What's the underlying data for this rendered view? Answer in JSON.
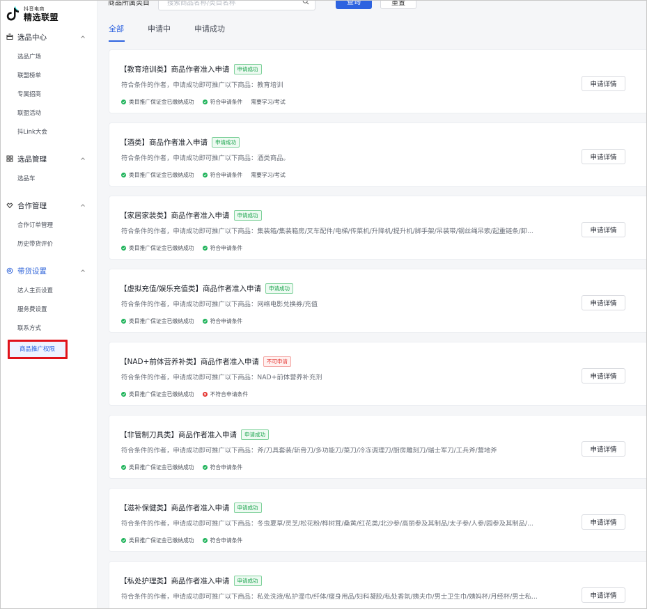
{
  "brand": {
    "small": "抖音电商",
    "big": "精选联盟",
    "colors": {
      "accent": "#2e63e0",
      "success": "#1fb35a",
      "danger": "#e53935",
      "highlight_box": "#e0121a"
    }
  },
  "sidebar": {
    "groups": [
      {
        "title": "选品中心",
        "icon": "box-icon",
        "items": [
          "选品广场",
          "联盟榜单",
          "专属招商",
          "联盟活动",
          "抖Link大会"
        ]
      },
      {
        "title": "选品管理",
        "icon": "grid-icon",
        "items": [
          "选品车"
        ]
      },
      {
        "title": "合作管理",
        "icon": "handshake-icon",
        "items": [
          "合作订单管理",
          "历史带货评价"
        ]
      },
      {
        "title": "带货设置",
        "icon": "settings-icon",
        "items": [
          "达人主页设置",
          "服务费设置",
          "联系方式",
          "商品推广权限"
        ]
      }
    ],
    "selected_item": "商品推广权限"
  },
  "filter": {
    "label": "商品所属类目",
    "search_placeholder": "搜索商品名称/类目名称",
    "query_label": "查询",
    "reset_label": "重置"
  },
  "tabs": [
    "全部",
    "申请中",
    "申请成功"
  ],
  "active_tab": "全部",
  "cards": [
    {
      "title": "【教育培训类】商品作者准入申请",
      "status": "申请成功",
      "status_type": "ok",
      "desc": "符合条件的作者，申请成功即可推广以下商品：教育培训",
      "tags": [
        {
          "type": "ok",
          "text": "类目推广保证金已缴纳成功"
        },
        {
          "type": "ok",
          "text": "符合申请条件"
        },
        {
          "type": "plain",
          "text": "需要学习/考试"
        }
      ],
      "button": "申请详情"
    },
    {
      "title": "【酒类】商品作者准入申请",
      "status": "申请成功",
      "status_type": "ok",
      "desc": "符合条件的作者，申请成功即可推广以下商品：酒类商品。",
      "tags": [
        {
          "type": "ok",
          "text": "类目推广保证金已缴纳成功"
        },
        {
          "type": "ok",
          "text": "符合申请条件"
        },
        {
          "type": "plain",
          "text": "需要学习/考试"
        }
      ],
      "button": "申请详情"
    },
    {
      "title": "【家居家装类】商品作者准入申请",
      "status": "申请成功",
      "status_type": "ok",
      "desc": "符合条件的作者，申请成功即可推广以下商品：集装箱/集装箱房/叉车配件/电梯/传菜机/升降机/提升机/脚手架/吊装带/钢丝绳吊索/起重链条/卸...",
      "tags": [
        {
          "type": "ok",
          "text": "类目推广保证金已缴纳成功"
        },
        {
          "type": "ok",
          "text": "符合申请条件"
        }
      ],
      "button": "申请详情"
    },
    {
      "title": "【虚拟充值/娱乐充值类】商品作者准入申请",
      "status": "申请成功",
      "status_type": "ok",
      "desc": "符合条件的作者，申请成功即可推广以下商品：网络电影兑换券/充值",
      "tags": [
        {
          "type": "ok",
          "text": "类目推广保证金已缴纳成功"
        },
        {
          "type": "ok",
          "text": "符合申请条件"
        }
      ],
      "button": "申请详情"
    },
    {
      "title": "【NAD+前体营养补类】商品作者准入申请",
      "status": "不可申请",
      "status_type": "no",
      "desc": "符合条件的作者，申请成功即可推广以下商品：NAD+前体营养补充剂",
      "tags": [
        {
          "type": "ok",
          "text": "类目推广保证金已缴纳成功"
        },
        {
          "type": "no",
          "text": "不符合申请条件"
        }
      ],
      "button": "申请详情"
    },
    {
      "title": "【非管制刀具类】商品作者准入申请",
      "status": "申请成功",
      "status_type": "ok",
      "desc": "符合条件的作者，申请成功即可推广以下商品：斧/刀具套装/斩骨刀/多功能刀/菜刀/冷冻调理刀/厨房雕刻刀/瑞士军刀/工兵斧/营地斧",
      "tags": [
        {
          "type": "ok",
          "text": "类目推广保证金已缴纳成功"
        },
        {
          "type": "ok",
          "text": "符合申请条件"
        }
      ],
      "button": "申请详情"
    },
    {
      "title": "【滋补保健类】商品作者准入申请",
      "status": "申请成功",
      "status_type": "ok",
      "desc": "符合条件的作者，申请成功即可推广以下商品：冬虫夏草/灵芝/松花粉/桦树茸/桑黄/红花类/北沙参/高丽参及其制品/太子参/人参/园参及其制品/...",
      "tags": [
        {
          "type": "ok",
          "text": "类目推广保证金已缴纳成功"
        },
        {
          "type": "ok",
          "text": "符合申请条件"
        }
      ],
      "button": "申请详情"
    },
    {
      "title": "【私处护理类】商品作者准入申请",
      "status": "申请成功",
      "status_type": "ok",
      "desc": "符合条件的作者，申请成功即可推广以下商品：私处洗液/私护湿巾/纤体/瘦身用品/妇科凝胶/私处香氛/姨夫巾/男士卫生巾/姨妈杯/月经杯/男士私...",
      "tags": [],
      "button": "申请详情"
    }
  ]
}
